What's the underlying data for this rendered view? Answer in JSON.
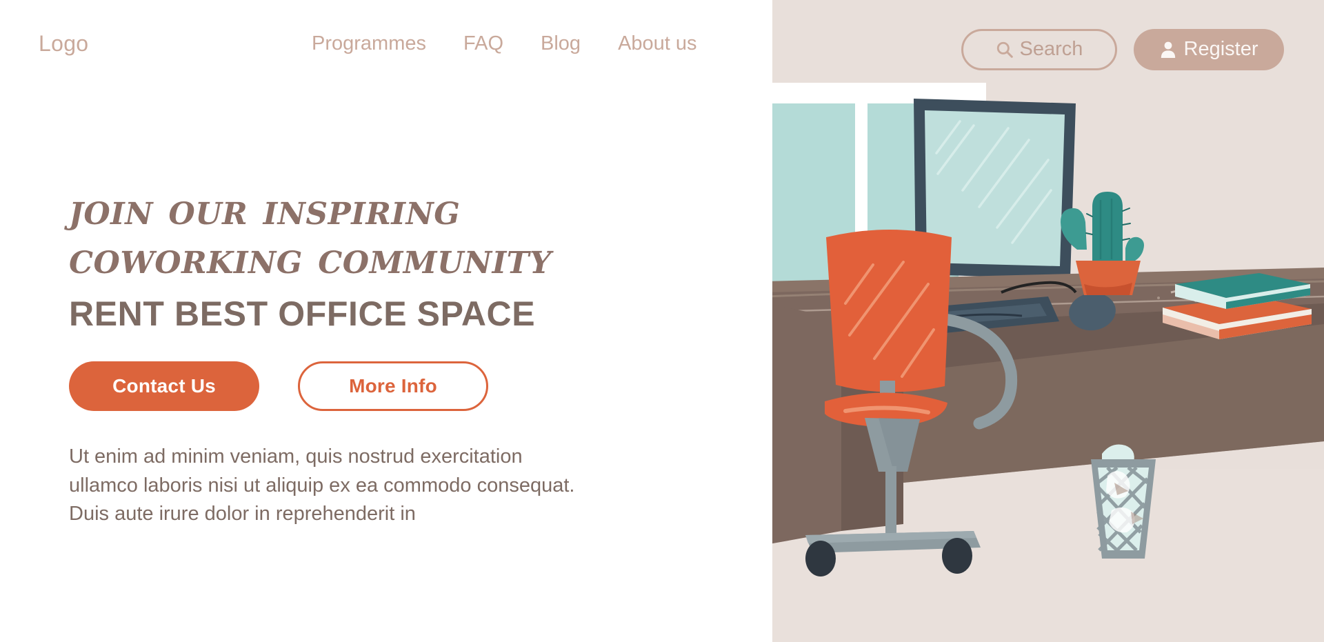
{
  "nav": {
    "logo": "Logo",
    "links": [
      {
        "label": "Programmes",
        "name": "nav-link-programmes"
      },
      {
        "label": "FAQ",
        "name": "nav-link-faq"
      },
      {
        "label": "Blog",
        "name": "nav-link-blog"
      },
      {
        "label": "About us",
        "name": "nav-link-about-us"
      }
    ],
    "search": {
      "label": "Search",
      "placeholder": "Search",
      "icon": "search-icon"
    },
    "register": {
      "label": "Register",
      "icon": "user-icon"
    }
  },
  "hero": {
    "headline_line1": "Join Our Inspiring",
    "headline_line2": "Coworking Community",
    "subheadline": "RENT BEST OFFICE SPACE",
    "primary_cta": "Contact Us",
    "secondary_cta": "More Info",
    "body": "Ut enim ad minim veniam, quis nostrud exercitation ullamco laboris nisi ut aliquip ex ea commodo consequat. Duis aute irure dolor in reprehenderit in"
  },
  "illustration": {
    "alt": "Flat illustration of an office workspace with desk, monitor, orange swivel chair, cactus, books and wastebasket",
    "objects": [
      "window-panes",
      "desk",
      "monitor",
      "keyboard",
      "computer-mouse",
      "cactus-plant",
      "book-stack",
      "office-chair",
      "wastebasket"
    ]
  },
  "colors": {
    "accent_orange": "#DC643C",
    "nav_rose": "#C9A99B",
    "heading_brown": "#8C7168",
    "body_brown": "#7D6B63",
    "panel_beige": "#E8DFDA",
    "window_teal": "#B4DBD7",
    "desk_brown": "#7D685F",
    "chair_orange": "#E2603A",
    "monitor_slate": "#3D4E5C",
    "plant_teal": "#2E8B84",
    "metal_gray": "#8E9BA0",
    "floor_beige": "#E9E0DB"
  }
}
